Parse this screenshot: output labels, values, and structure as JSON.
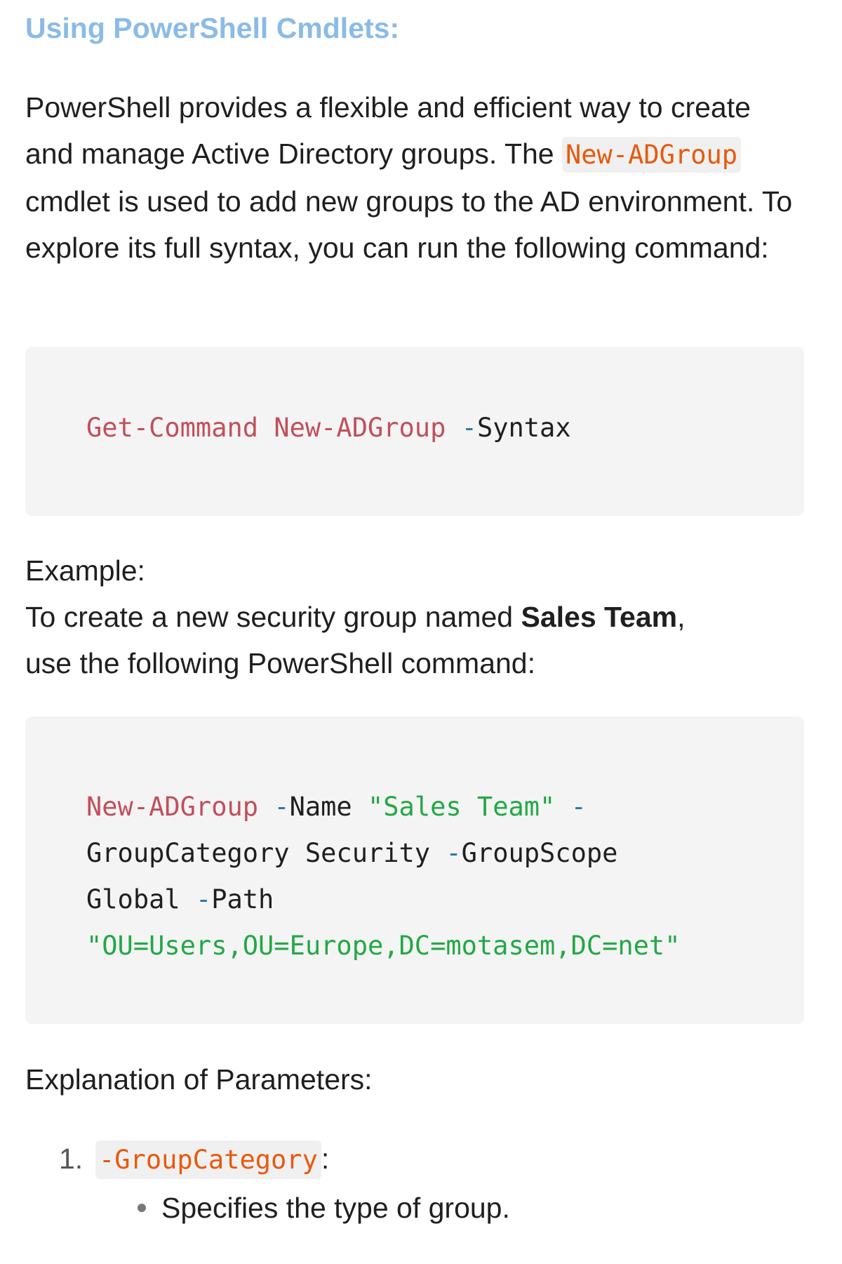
{
  "section": {
    "heading": "Using PowerShell Cmdlets:",
    "intro": {
      "before_code": "PowerShell provides a flexible and efficient way to create and manage Active Directory groups. The ",
      "inline_code": "New-ADGroup",
      "after_code": " cmdlet is used to add new groups to the AD environment. To explore its full syntax, you can run the following command:"
    },
    "code_block_1": {
      "cmd": "Get-Command",
      "space1": " ",
      "arg": "New-ADGroup",
      "space2": " ",
      "dash": "-",
      "option": "Syntax"
    },
    "example": {
      "label": "Example:",
      "line_before_bold": "To create a new security group named ",
      "bold": "Sales Team",
      "after_bold": ",",
      "line2": "use the following PowerShell command:"
    },
    "code_block_2": {
      "line1_cmd": "New-ADGroup",
      "line1_p1": " -",
      "line1_name": "Name",
      "line1_str": " \"Sales Team\"",
      "line1_dash": " -",
      "line2_a": "GroupCategory Security ",
      "line2_dash": "-",
      "line2_b": "GroupScope",
      "line3_a": "Global ",
      "line3_dash": "-",
      "line3_b": "Path",
      "line4_str": "\"OU=Users,OU=Europe,DC=motasem,DC=net\""
    },
    "explanation_heading": "Explanation of Parameters:",
    "params": [
      {
        "number": "1.",
        "code": "-GroupCategory",
        "suffix": ":",
        "bullet": "Specifies the type of group."
      }
    ]
  }
}
